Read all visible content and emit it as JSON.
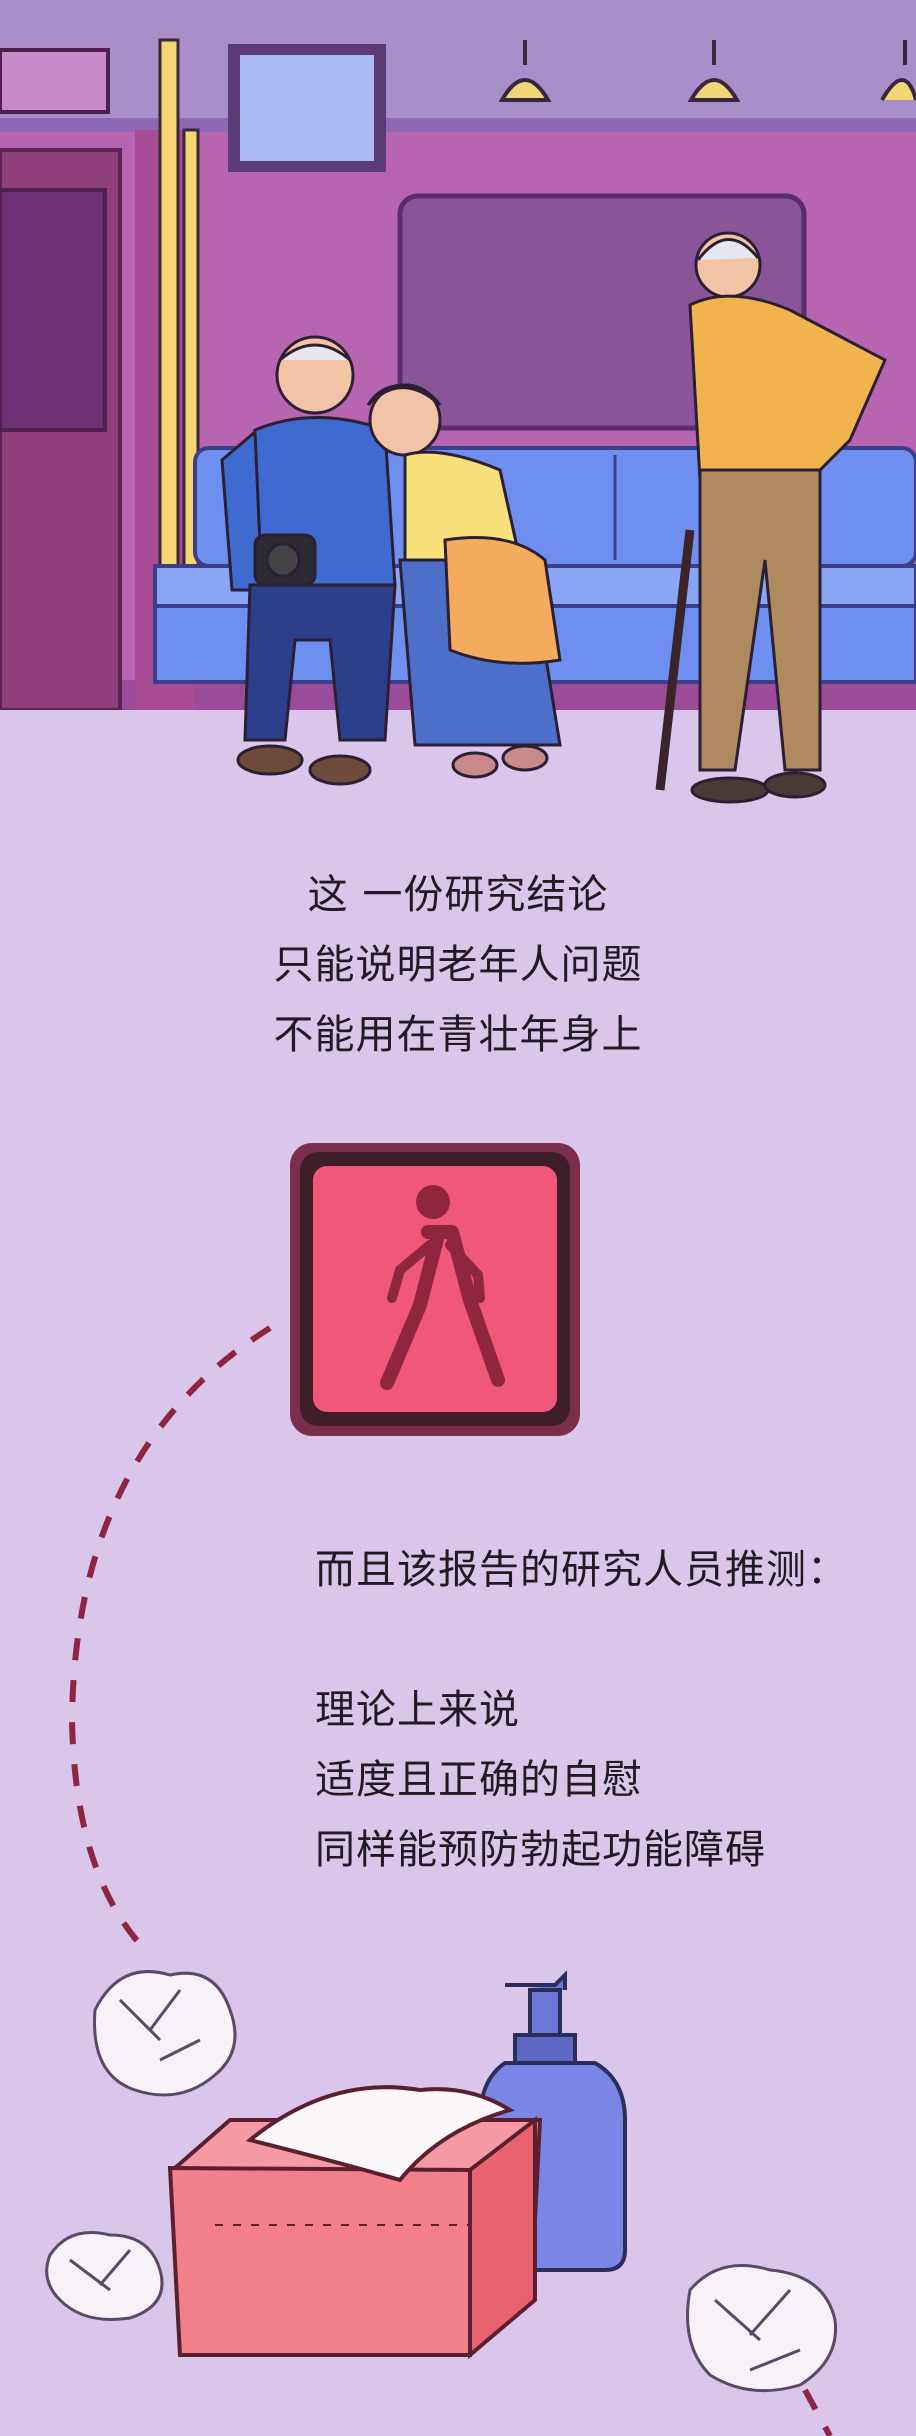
{
  "palette": {
    "page_bg": "#d9c6ea",
    "train_wall": "#a94f9e",
    "train_ceiling": "#a98fc9",
    "seat": "#6e8ff0",
    "pole": "#f4d672",
    "sign_red": "#f0577a",
    "sign_frame": "#7a2e4b",
    "dash": "#8e2640",
    "tissue_box": "#f27f8a",
    "bottle": "#6c78d8"
  },
  "icons": {
    "walking": "pedestrian-walking-icon"
  },
  "texts": {
    "block1": [
      "这 一份研究结论",
      "只能说明老年人问题",
      "不能用在青壮年身上"
    ],
    "block2": "而且该报告的研究人员推测：",
    "block3": [
      "理论上来说",
      "适度且正确的自慰",
      "同样能预防勃起功能障碍"
    ]
  }
}
